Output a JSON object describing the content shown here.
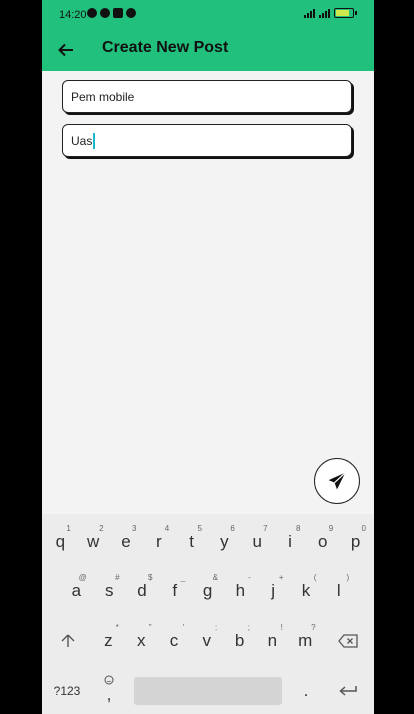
{
  "status_bar": {
    "time": "14:20"
  },
  "app_bar": {
    "title": "Create New Post"
  },
  "form": {
    "title_value": "Pem mobile",
    "body_value": "Uas"
  },
  "keyboard": {
    "row1": [
      {
        "k": "q",
        "h": "1"
      },
      {
        "k": "w",
        "h": "2"
      },
      {
        "k": "e",
        "h": "3"
      },
      {
        "k": "r",
        "h": "4"
      },
      {
        "k": "t",
        "h": "5"
      },
      {
        "k": "y",
        "h": "6"
      },
      {
        "k": "u",
        "h": "7"
      },
      {
        "k": "i",
        "h": "8"
      },
      {
        "k": "o",
        "h": "9"
      },
      {
        "k": "p",
        "h": "0"
      }
    ],
    "row2": [
      {
        "k": "a",
        "h": "@"
      },
      {
        "k": "s",
        "h": "#"
      },
      {
        "k": "d",
        "h": "$"
      },
      {
        "k": "f",
        "h": "_"
      },
      {
        "k": "g",
        "h": "&"
      },
      {
        "k": "h",
        "h": "-"
      },
      {
        "k": "j",
        "h": "+"
      },
      {
        "k": "k",
        "h": "("
      },
      {
        "k": "l",
        "h": ")"
      }
    ],
    "row3": [
      {
        "k": "z",
        "h": "*"
      },
      {
        "k": "x",
        "h": "\""
      },
      {
        "k": "c",
        "h": "'"
      },
      {
        "k": "v",
        "h": ":"
      },
      {
        "k": "b",
        "h": ";"
      },
      {
        "k": "n",
        "h": "!"
      },
      {
        "k": "m",
        "h": "?"
      }
    ],
    "symbols_label": "?123",
    "comma_label": ",",
    "period_label": "."
  },
  "icons": {
    "back": "arrow-left-icon",
    "send": "paper-plane-icon",
    "shift": "shift-arrow-icon",
    "backspace": "backspace-icon",
    "emoji": "emoji-icon",
    "enter": "enter-icon"
  },
  "colors": {
    "accent": "#21c17d",
    "caret": "#1fb8c9"
  }
}
